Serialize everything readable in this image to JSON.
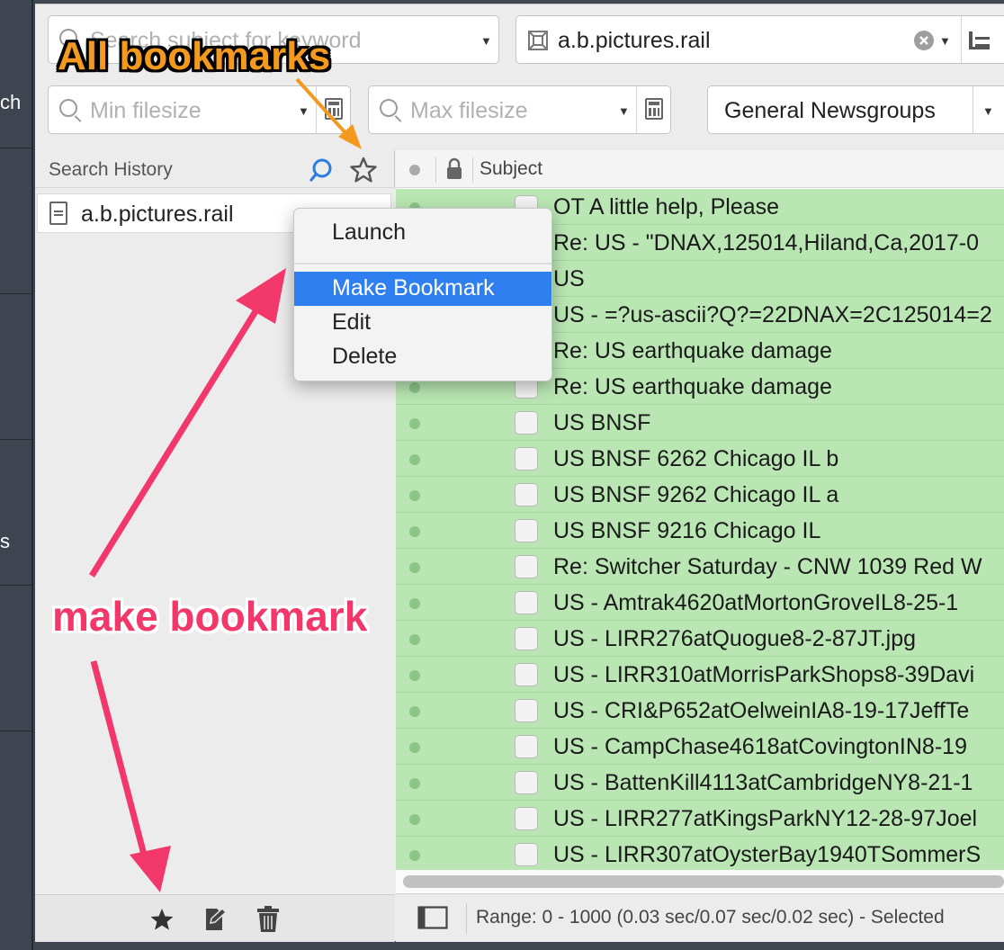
{
  "sidebar": {
    "partial_label_1": "ch",
    "partial_label_2": "s"
  },
  "search": {
    "subject_placeholder": "Search subject for keyword",
    "newsgroup_value": "a.b.pictures.rail",
    "min_filesize_placeholder": "Min filesize",
    "max_filesize_placeholder": "Max filesize",
    "group_scope": "General Newsgroups"
  },
  "history_panel": {
    "title": "Search History",
    "items": [
      "a.b.pictures.rail"
    ]
  },
  "context_menu": {
    "items": [
      "Launch",
      "Make Bookmark",
      "Edit",
      "Delete"
    ]
  },
  "table": {
    "columns": [
      "Subject"
    ],
    "rows": [
      "OT A little help, Please",
      "Re: US - \"DNAX,125014,Hiland,Ca,2017-0",
      "US",
      "US - =?us-ascii?Q?=22DNAX=2C125014=2",
      "Re: US earthquake damage",
      "Re: US earthquake damage",
      "US BNSF",
      "US BNSF 6262 Chicago IL b",
      "US BNSF 9262 Chicago IL a",
      "US BNSF 9216 Chicago IL",
      "Re: Switcher Saturday - CNW 1039 Red W",
      "US - Amtrak4620atMortonGroveIL8-25-1",
      "US - LIRR276atQuogue8-2-87JT.jpg",
      "US - LIRR310atMorrisParkShops8-39Davi",
      "US - CRI&P652atOelweinIA8-19-17JeffTe",
      "US - CampChase4618atCovingtonIN8-19",
      "US - BattenKill4113atCambridgeNY8-21-1",
      "US - LIRR277atKingsParkNY12-28-97Joel",
      "US - LIRR307atOysterBay1940TSommerS"
    ]
  },
  "status_bar": {
    "text": "Range: 0 - 1000 (0.03 sec/0.07 sec/0.02 sec) - Selected"
  },
  "annotations": {
    "all_bookmarks": "All bookmarks",
    "make_bookmark": "make bookmark"
  },
  "colors": {
    "row_bg": "#b9e6b3",
    "menu_highlight": "#2f7ff0",
    "annotation_orange": "#f39a1e",
    "annotation_pink": "#f2386a"
  }
}
